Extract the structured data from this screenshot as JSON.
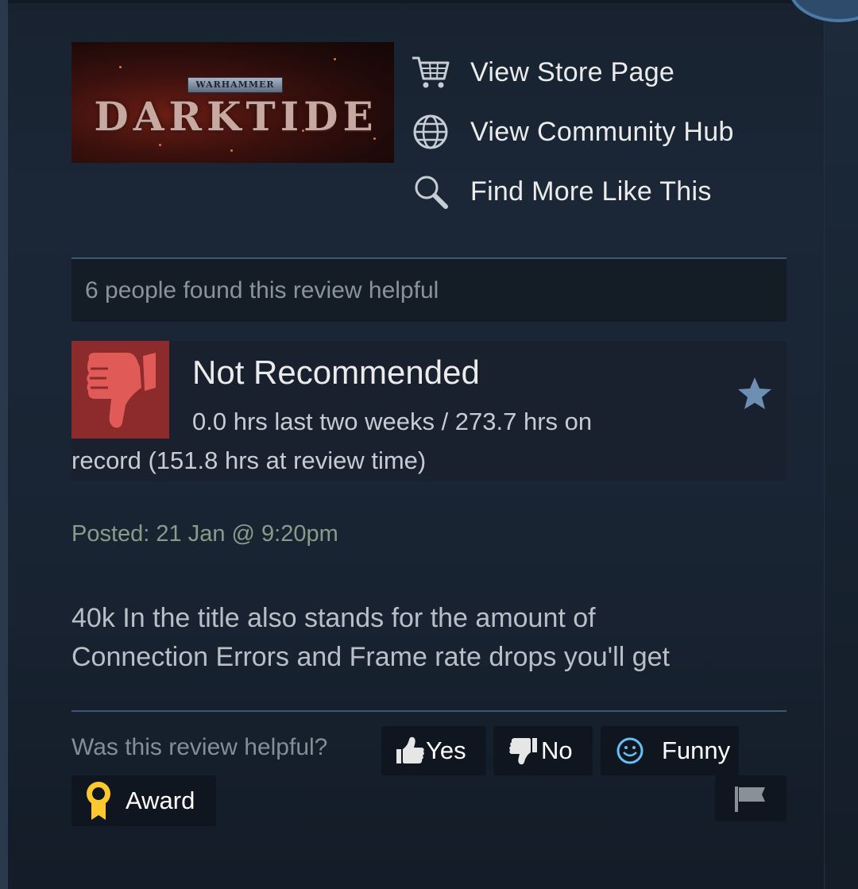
{
  "game": {
    "capsule_franchise": "WARHAMMER",
    "capsule_title": "DARKTIDE",
    "links": [
      {
        "label": "View Store Page",
        "icon": "cart-icon"
      },
      {
        "label": "View Community Hub",
        "icon": "globe-icon"
      },
      {
        "label": "Find More Like This",
        "icon": "magnifier-icon"
      }
    ]
  },
  "review": {
    "helpful_count_text": "6 people found this review helpful",
    "verdict": "Not Recommended",
    "verdict_icon": "thumbs-down-icon",
    "hours_line1": "0.0 hrs last two weeks / 273.7 hrs on",
    "hours_line2": "record (151.8 hrs at review time)",
    "posted": "Posted: 21 Jan @ 9:20pm",
    "body_line1": "40k In the title also stands for the amount of",
    "body_line2": "Connection Errors and Frame rate drops you'll get"
  },
  "actions": {
    "question": "Was this review helpful?",
    "yes_label": "Yes",
    "no_label": "No",
    "funny_label": "Funny",
    "award_label": "Award"
  },
  "colors": {
    "accent": "#66c0f4",
    "thumb_down_bg": "#8c2a2c",
    "thumb_down_fg": "#e05a57",
    "award": "#ffc82c"
  }
}
